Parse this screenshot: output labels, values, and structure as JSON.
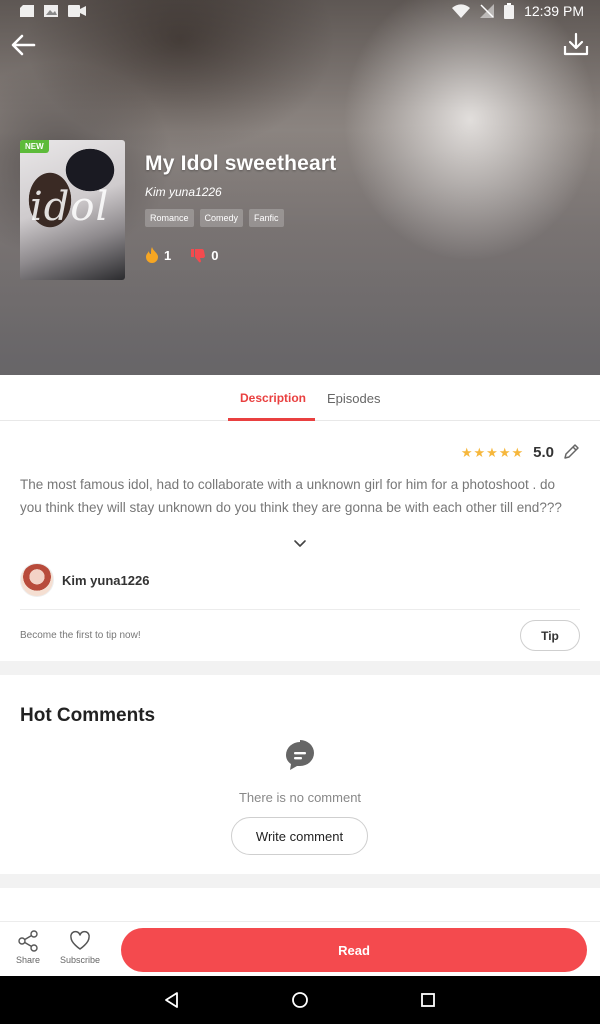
{
  "status_bar": {
    "time": "12:39 PM"
  },
  "book": {
    "badge": "NEW",
    "cover_title": "idol",
    "title": "My Idol sweetheart",
    "author": "Kim yuna1226",
    "genres": [
      "Romance",
      "Comedy",
      "Fanfic"
    ],
    "likes": "1",
    "dislikes": "0"
  },
  "tabs": {
    "description": "Description",
    "episodes": "Episodes",
    "active": "Description"
  },
  "description": {
    "rating": "5.0",
    "stars": 5,
    "text": "The most famous idol, had to collaborate with a unknown girl for him for a photoshoot . do you think they will stay unknown do you think they are gonna be with each other till end???",
    "author_name": "Kim yuna1226"
  },
  "tip": {
    "prompt": "Become the first to tip now!",
    "button": "Tip"
  },
  "comments": {
    "title": "Hot Comments",
    "empty_text": "There is no comment",
    "write_button": "Write comment"
  },
  "action_bar": {
    "share_label": "Share",
    "subscribe_label": "Subscribe",
    "read_label": "Read"
  },
  "colors": {
    "accent": "#f44a4e",
    "star": "#f6b73c",
    "new_badge": "#5dbb3a"
  },
  "icons": [
    "back-arrow-icon",
    "download-icon",
    "fire-icon",
    "thumbs-down-icon",
    "edit-icon",
    "chevron-down-icon",
    "comment-bubble-icon",
    "share-icon",
    "heart-icon"
  ]
}
